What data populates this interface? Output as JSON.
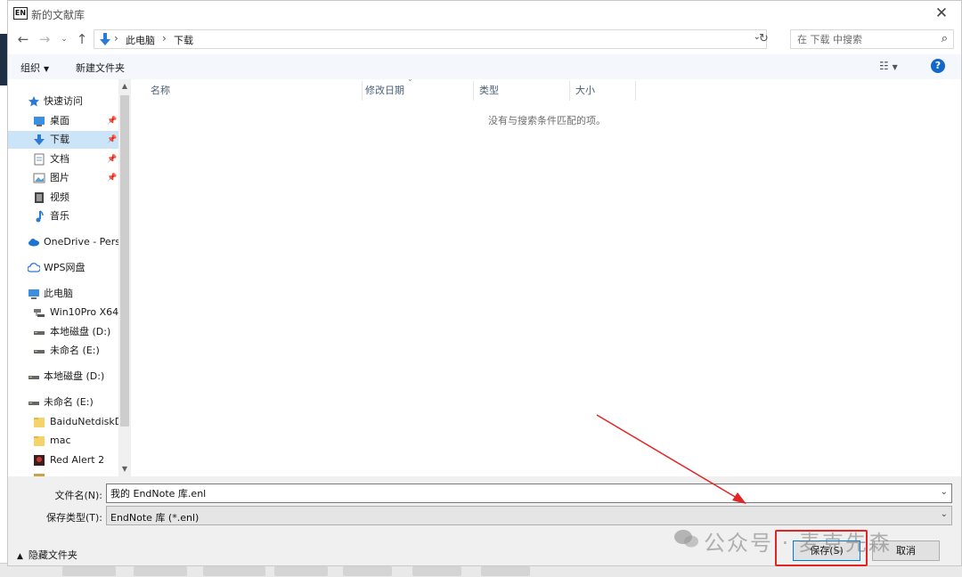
{
  "window": {
    "app_badge": "EN",
    "title": "新的文献库"
  },
  "address_bar": {
    "breadcrumbs": [
      "此电脑",
      "下载"
    ],
    "search_placeholder": "在 下载 中搜索"
  },
  "toolbar": {
    "organize_label": "组织",
    "new_folder_label": "新建文件夹"
  },
  "nav_pane": {
    "items": [
      {
        "label": "快速访问",
        "icon": "star-icon"
      },
      {
        "label": "桌面",
        "icon": "desktop-icon",
        "pinned": true
      },
      {
        "label": "下载",
        "icon": "download-icon",
        "pinned": true,
        "selected": true
      },
      {
        "label": "文档",
        "icon": "document-icon",
        "pinned": true
      },
      {
        "label": "图片",
        "icon": "picture-icon",
        "pinned": true
      },
      {
        "label": "视频",
        "icon": "video-icon"
      },
      {
        "label": "音乐",
        "icon": "music-icon"
      },
      {
        "label": "OneDrive - Perso",
        "icon": "onedrive-icon"
      },
      {
        "label": "WPS网盘",
        "icon": "cloud-icon"
      },
      {
        "label": "此电脑",
        "icon": "computer-icon"
      },
      {
        "label": "Win10Pro X64",
        "icon": "network-drive-icon"
      },
      {
        "label": "本地磁盘 (D:)",
        "icon": "drive-icon"
      },
      {
        "label": "未命名 (E:)",
        "icon": "drive-icon"
      },
      {
        "label": "本地磁盘 (D:)",
        "icon": "drive-icon"
      },
      {
        "label": "未命名 (E:)",
        "icon": "drive-icon"
      },
      {
        "label": "BaiduNetdiskD",
        "icon": "folder-icon"
      },
      {
        "label": "mac",
        "icon": "folder-icon"
      },
      {
        "label": "Red Alert 2",
        "icon": "game-icon"
      }
    ]
  },
  "file_list": {
    "columns": [
      "名称",
      "修改日期",
      "类型",
      "大小"
    ],
    "empty_message": "没有与搜索条件匹配的项。"
  },
  "save_form": {
    "filename_label": "文件名(N):",
    "filename_value": "我的 EndNote 库.enl",
    "filetype_label": "保存类型(T):",
    "filetype_value": "EndNote 库 (*.enl)",
    "hide_folders_label": "隐藏文件夹",
    "save_button": "保存(S)",
    "cancel_button": "取消"
  },
  "watermark": {
    "text": "公众号 · 麦克先森"
  },
  "colors": {
    "accent": "#0078d7",
    "selection": "#cce4f7",
    "annotation": "#e22424"
  }
}
